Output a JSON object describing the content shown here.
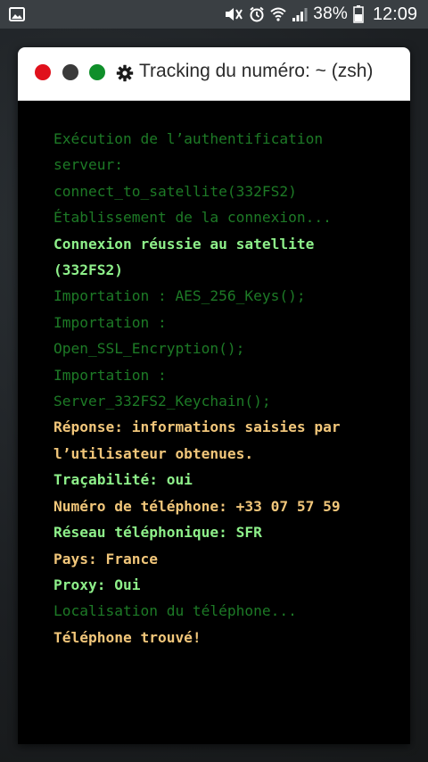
{
  "status_bar": {
    "battery_percent": "38%",
    "time": "12:09",
    "icons": [
      "image-icon",
      "mute-icon",
      "alarm-icon",
      "wifi-icon",
      "signal-icon",
      "battery-icon"
    ]
  },
  "window": {
    "title": "Tracking du numéro: ~ (zsh)",
    "icons": [
      "close-dot",
      "minimize-dot",
      "maximize-dot",
      "gear-icon"
    ]
  },
  "colors": {
    "dim_green": "#1d7a26",
    "bright_green": "#8ef08a",
    "amber": "#f1c67a",
    "close": "#e0111c",
    "maximize": "#0f8f2a"
  },
  "terminal": {
    "lines": [
      {
        "text": "Exécution de l’authentification",
        "style": "dim"
      },
      {
        "text": "serveur:",
        "style": "dim"
      },
      {
        "text": "connect_to_satellite(332FS2)",
        "style": "dim"
      },
      {
        "text": "Établissement de la connexion...",
        "style": "dim"
      },
      {
        "text": "Connexion réussie au satellite",
        "style": "bright"
      },
      {
        "text": "(332FS2)",
        "style": "bright"
      },
      {
        "text": "Importation : AES_256_Keys();",
        "style": "dim"
      },
      {
        "text": "Importation :",
        "style": "dim"
      },
      {
        "text": "Open_SSL_Encryption();",
        "style": "dim"
      },
      {
        "text": "Importation :",
        "style": "dim"
      },
      {
        "text": "Server_332FS2_Keychain();",
        "style": "dim"
      },
      {
        "text": "Réponse: informations saisies par",
        "style": "amber"
      },
      {
        "text": "l’utilisateur obtenues.",
        "style": "amber"
      },
      {
        "text": "Traçabilité: oui",
        "style": "bright"
      },
      {
        "text": "Numéro de téléphone: +33 07 57 59",
        "style": "amber"
      },
      {
        "text": "Réseau téléphonique: SFR",
        "style": "bright"
      },
      {
        "text": "Pays: France",
        "style": "amber"
      },
      {
        "text": "Proxy: Oui",
        "style": "bright"
      },
      {
        "text": "Localisation du téléphone...",
        "style": "dim"
      },
      {
        "text": "Téléphone trouvé!",
        "style": "amber"
      }
    ]
  }
}
